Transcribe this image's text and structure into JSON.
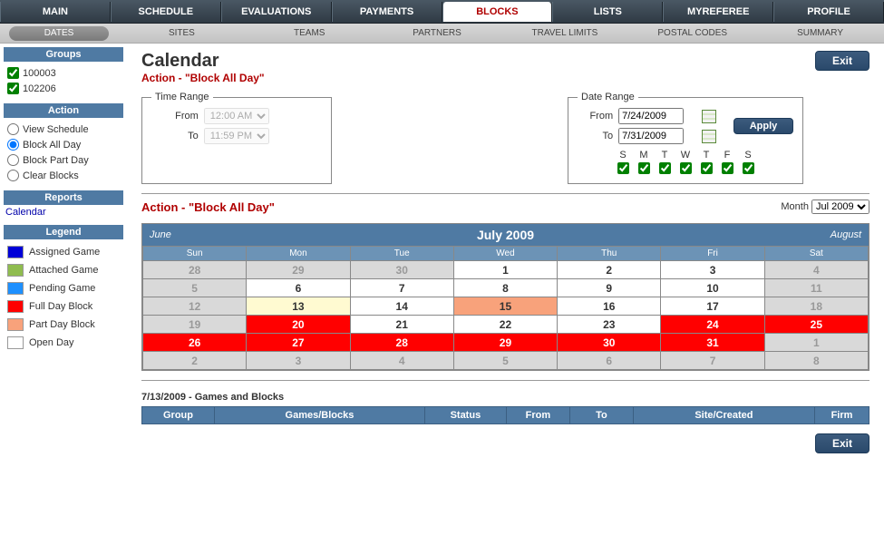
{
  "topnav": [
    "MAIN",
    "SCHEDULE",
    "EVALUATIONS",
    "PAYMENTS",
    "BLOCKS",
    "LISTS",
    "MYREFEREE",
    "PROFILE"
  ],
  "topnav_active": "BLOCKS",
  "subnav": {
    "pill": "DATES",
    "items": [
      "SITES",
      "TEAMS",
      "PARTNERS",
      "TRAVEL LIMITS",
      "POSTAL CODES",
      "SUMMARY"
    ]
  },
  "sidebar": {
    "groups_hdr": "Groups",
    "groups": [
      "100003",
      "102206"
    ],
    "action_hdr": "Action",
    "actions": [
      "View Schedule",
      "Block All Day",
      "Block Part Day",
      "Clear Blocks"
    ],
    "action_selected": "Block All Day",
    "reports_hdr": "Reports",
    "reports_link": "Calendar",
    "legend_hdr": "Legend",
    "legend": [
      {
        "label": "Assigned Game",
        "color": "#0000d8"
      },
      {
        "label": "Attached Game",
        "color": "#8fbc4f"
      },
      {
        "label": "Pending Game",
        "color": "#1e90ff"
      },
      {
        "label": "Full Day Block",
        "color": "#ff0000"
      },
      {
        "label": "Part Day Block",
        "color": "#f8a27b"
      },
      {
        "label": "Open Day",
        "color": "#ffffff"
      }
    ]
  },
  "page": {
    "title": "Calendar",
    "action_line": "Action - \"Block All Day\"",
    "exit": "Exit",
    "apply": "Apply"
  },
  "time_range": {
    "legend": "Time Range",
    "from_lbl": "From",
    "to_lbl": "To",
    "from_val": "12:00 AM",
    "to_val": "11:59 PM"
  },
  "date_range": {
    "legend": "Date Range",
    "from_lbl": "From",
    "to_lbl": "To",
    "from_val": "7/24/2009",
    "to_val": "7/31/2009",
    "dow": [
      "S",
      "M",
      "T",
      "W",
      "T",
      "F",
      "S"
    ]
  },
  "month_row": {
    "action": "Action - \"Block All Day\"",
    "month_lbl": "Month",
    "month_val": "Jul 2009"
  },
  "calendar": {
    "prev": "June",
    "current": "July 2009",
    "next": "August",
    "dow": [
      "Sun",
      "Mon",
      "Tue",
      "Wed",
      "Thu",
      "Fri",
      "Sat"
    ],
    "weeks": [
      [
        {
          "d": "28",
          "c": "out"
        },
        {
          "d": "29",
          "c": "out"
        },
        {
          "d": "30",
          "c": "out"
        },
        {
          "d": "1",
          "c": "in"
        },
        {
          "d": "2",
          "c": "in"
        },
        {
          "d": "3",
          "c": "in"
        },
        {
          "d": "4",
          "c": "out"
        }
      ],
      [
        {
          "d": "5",
          "c": "out"
        },
        {
          "d": "6",
          "c": "in"
        },
        {
          "d": "7",
          "c": "in"
        },
        {
          "d": "8",
          "c": "in"
        },
        {
          "d": "9",
          "c": "in"
        },
        {
          "d": "10",
          "c": "in"
        },
        {
          "d": "11",
          "c": "out"
        }
      ],
      [
        {
          "d": "12",
          "c": "out"
        },
        {
          "d": "13",
          "c": "hl"
        },
        {
          "d": "14",
          "c": "in"
        },
        {
          "d": "15",
          "c": "peach"
        },
        {
          "d": "16",
          "c": "in"
        },
        {
          "d": "17",
          "c": "in"
        },
        {
          "d": "18",
          "c": "out"
        }
      ],
      [
        {
          "d": "19",
          "c": "out"
        },
        {
          "d": "20",
          "c": "red"
        },
        {
          "d": "21",
          "c": "in"
        },
        {
          "d": "22",
          "c": "in"
        },
        {
          "d": "23",
          "c": "in"
        },
        {
          "d": "24",
          "c": "red"
        },
        {
          "d": "25",
          "c": "red"
        }
      ],
      [
        {
          "d": "26",
          "c": "red"
        },
        {
          "d": "27",
          "c": "red"
        },
        {
          "d": "28",
          "c": "red"
        },
        {
          "d": "29",
          "c": "red"
        },
        {
          "d": "30",
          "c": "red"
        },
        {
          "d": "31",
          "c": "red"
        },
        {
          "d": "1",
          "c": "out"
        }
      ],
      [
        {
          "d": "2",
          "c": "out"
        },
        {
          "d": "3",
          "c": "out"
        },
        {
          "d": "4",
          "c": "out"
        },
        {
          "d": "5",
          "c": "out"
        },
        {
          "d": "6",
          "c": "out"
        },
        {
          "d": "7",
          "c": "out"
        },
        {
          "d": "8",
          "c": "out"
        }
      ]
    ]
  },
  "games_blocks": {
    "title": "7/13/2009 - Games and Blocks",
    "cols": [
      "Group",
      "Games/Blocks",
      "Status",
      "From",
      "To",
      "Site/Created",
      "Firm"
    ]
  }
}
